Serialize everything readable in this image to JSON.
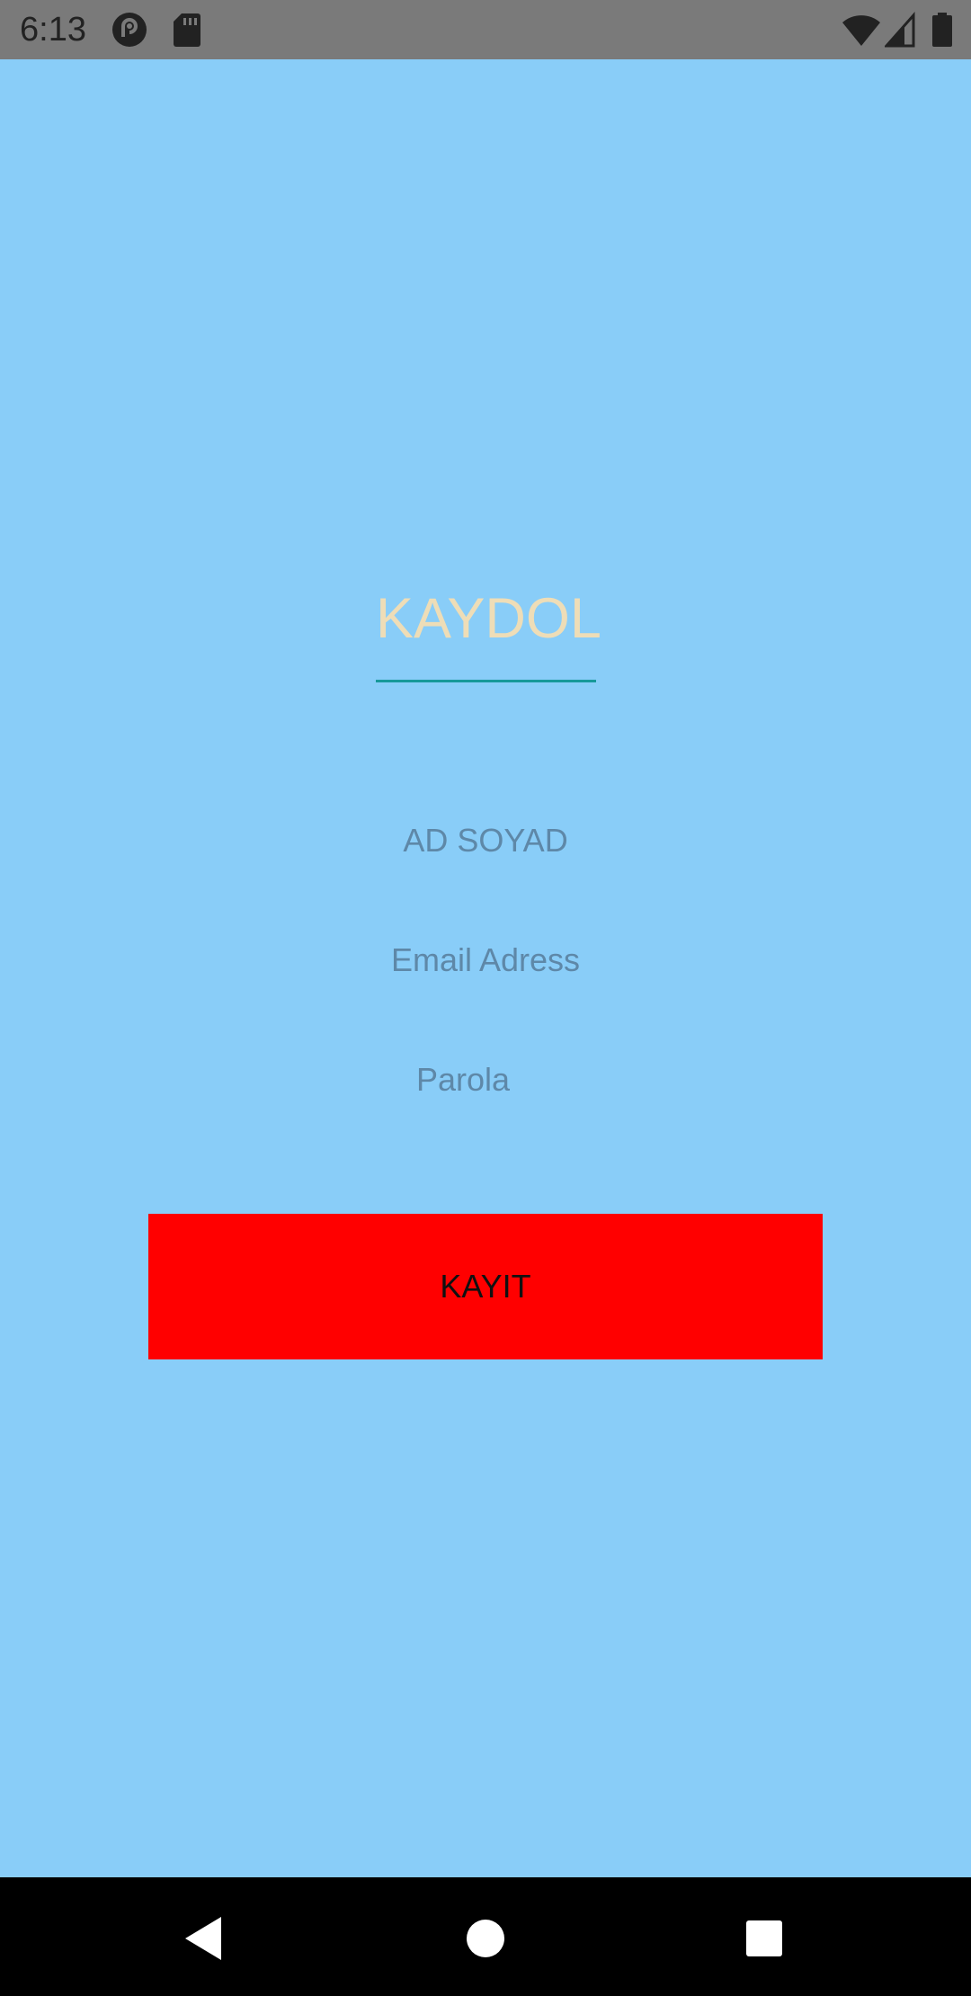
{
  "status_bar": {
    "time": "6:13",
    "left_icons": [
      "pocket-casts-icon",
      "sd-card-icon"
    ],
    "right_icons": [
      "wifi-icon",
      "signal-icon",
      "battery-icon"
    ]
  },
  "form": {
    "title": "KAYDOL",
    "fields": {
      "name_placeholder": "AD SOYAD",
      "email_placeholder": "Email Adress",
      "password_placeholder": "Parola"
    },
    "submit_label": "KAYIT"
  },
  "nav_bar": {
    "buttons": [
      "back-icon",
      "home-icon",
      "recents-icon"
    ]
  },
  "colors": {
    "background": "#89CDF8",
    "title": "#EEDDB7",
    "underline": "#17999A",
    "button": "#FF0000"
  }
}
